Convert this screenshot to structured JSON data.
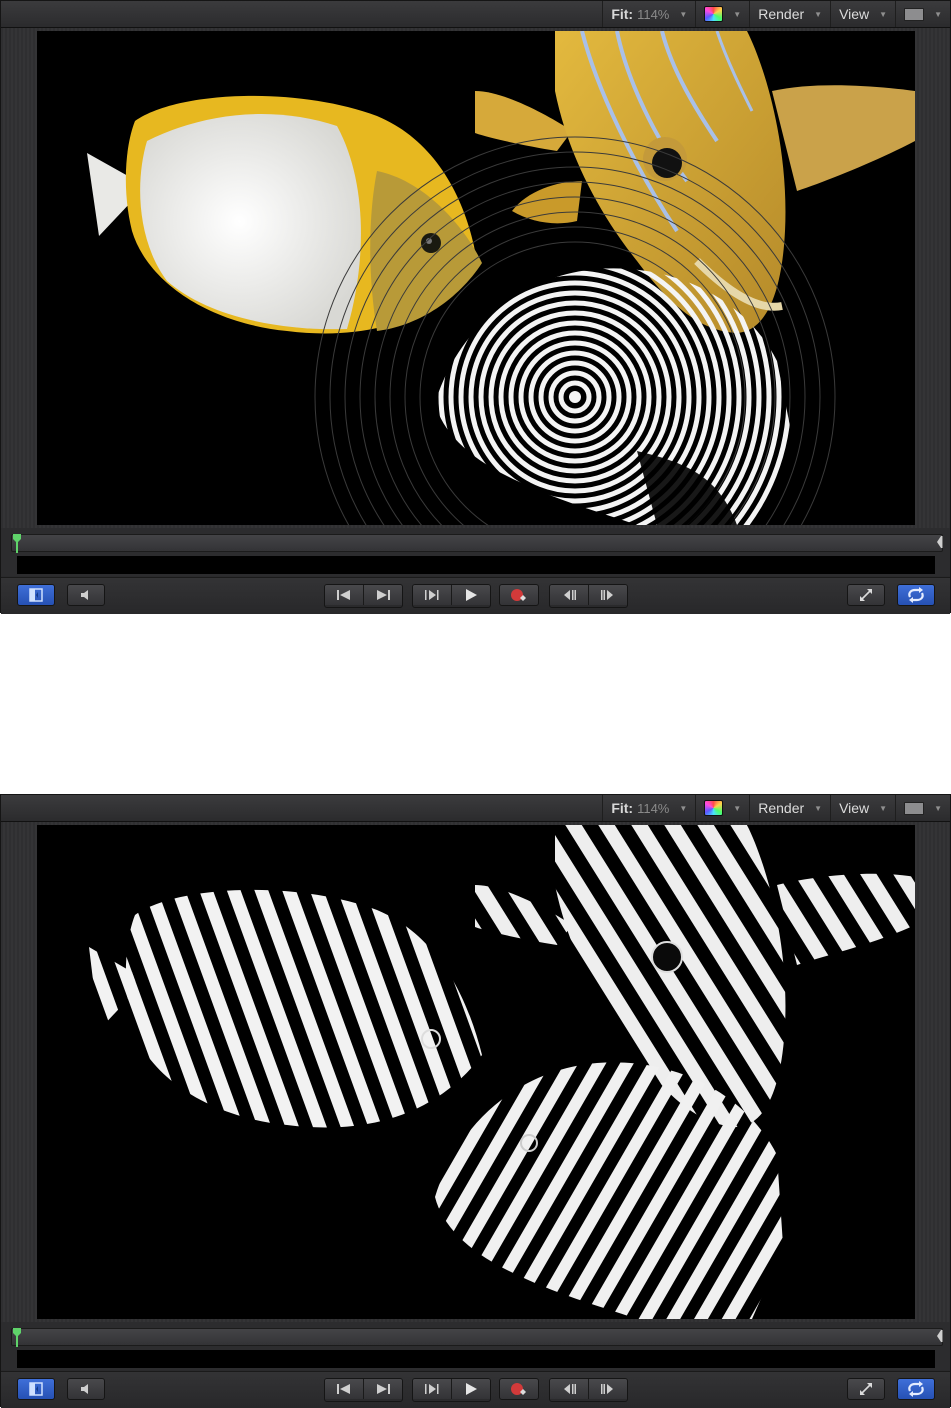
{
  "viewers": [
    {
      "id": "before",
      "toolbar": {
        "fit_label": "Fit:",
        "fit_value": "114%",
        "render_label": "Render",
        "view_label": "View"
      }
    },
    {
      "id": "after",
      "toolbar": {
        "fit_label": "Fit:",
        "fit_value": "114%",
        "render_label": "Render",
        "view_label": "View"
      }
    }
  ],
  "colors": {
    "active_button": "#2f60c8",
    "record": "#d23a3a",
    "playhead": "#5fd36a",
    "fish_yellow": "#e6b820",
    "fish_white": "#f2f2ee",
    "fish_gold": "#c9a23a"
  },
  "transport_icons": [
    "show-hide-panel-icon",
    "audio-icon",
    "go-to-start-icon",
    "go-to-end-icon",
    "play-from-start-icon",
    "play-icon",
    "record-icon",
    "previous-frame-icon",
    "next-frame-icon",
    "fullscreen-icon",
    "loop-icon"
  ]
}
